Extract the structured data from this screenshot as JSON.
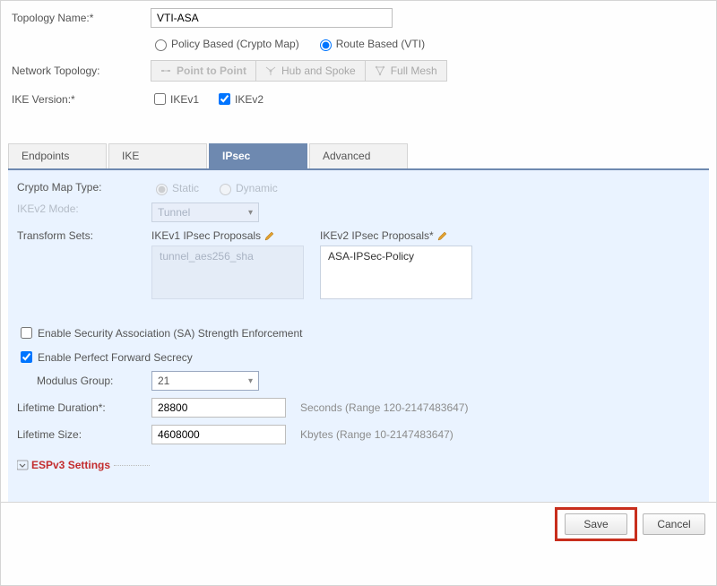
{
  "topology": {
    "label": "Topology Name:*",
    "value": "VTI-ASA",
    "policy_mode": {
      "policy_label": "Policy Based (Crypto Map)",
      "route_label": "Route Based (VTI)",
      "selected": "route"
    }
  },
  "network_topology": {
    "label": "Network Topology:",
    "options": {
      "p2p": "Point to Point",
      "hub": "Hub and Spoke",
      "full": "Full Mesh"
    }
  },
  "ike_version": {
    "label": "IKE Version:*",
    "ikev1_label": "IKEv1",
    "ikev2_label": "IKEv2",
    "ikev1_checked": false,
    "ikev2_checked": true
  },
  "tabs": {
    "endpoints": "Endpoints",
    "ike": "IKE",
    "ipsec": "IPsec",
    "advanced": "Advanced"
  },
  "ipsec": {
    "crypto_label": "Crypto Map Type:",
    "crypto_static": "Static",
    "crypto_dynamic": "Dynamic",
    "ikev2_mode_label": "IKEv2 Mode:",
    "ikev2_mode_value": "Tunnel",
    "transform_label": "Transform Sets:",
    "ikev1_proposals_title": "IKEv1 IPsec Proposals",
    "ikev1_proposals_value": "tunnel_aes256_sha",
    "ikev2_proposals_title": "IKEv2 IPsec Proposals*",
    "ikev2_proposals_value": "ASA-IPSec-Policy",
    "sa_enforce_label": "Enable Security Association (SA) Strength Enforcement",
    "pfs_label": "Enable Perfect Forward Secrecy",
    "modulus_label": "Modulus Group:",
    "modulus_value": "21",
    "lifetime_dur_label": "Lifetime Duration*:",
    "lifetime_dur_value": "28800",
    "lifetime_dur_hint": "Seconds (Range 120-2147483647)",
    "lifetime_size_label": "Lifetime Size:",
    "lifetime_size_value": "4608000",
    "lifetime_size_hint": "Kbytes (Range 10-2147483647)",
    "esp_title": "ESPv3 Settings"
  },
  "buttons": {
    "save": "Save",
    "cancel": "Cancel"
  }
}
